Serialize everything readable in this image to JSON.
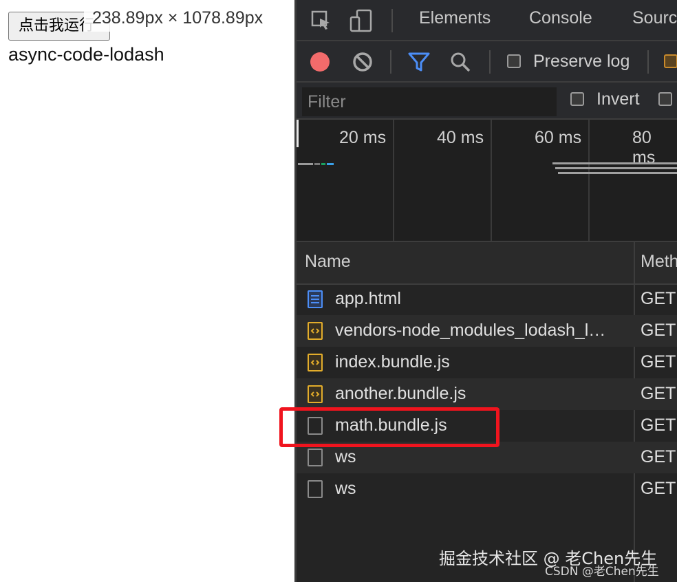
{
  "page": {
    "run_button": "点击我运行",
    "dimension_tooltip": "238.89px × 1078.89px",
    "body_text": "async-code-lodash"
  },
  "devtools": {
    "tabs": [
      "Elements",
      "Console",
      "Sourc"
    ],
    "toolbar2": {
      "preserve_log_label": "Preserve log",
      "record_color": "#f26b6b",
      "filter_icon_color": "#4c8ef7"
    },
    "filter": {
      "placeholder": "Filter",
      "invert_label": "Invert"
    },
    "timeline": {
      "ticks": [
        "20 ms",
        "40 ms",
        "60 ms",
        "80 ms"
      ]
    },
    "table": {
      "columns": [
        "Name",
        "Meth"
      ],
      "rows": [
        {
          "name": "app.html",
          "method": "GET",
          "icon": "document-icon"
        },
        {
          "name": "vendors-node_modules_lodash_l…",
          "method": "GET",
          "icon": "script-icon"
        },
        {
          "name": "index.bundle.js",
          "method": "GET",
          "icon": "script-icon"
        },
        {
          "name": "another.bundle.js",
          "method": "GET",
          "icon": "script-icon"
        },
        {
          "name": "math.bundle.js",
          "method": "GET",
          "icon": "blank-file-icon"
        },
        {
          "name": "ws",
          "method": "GET",
          "icon": "blank-file-icon"
        },
        {
          "name": "ws",
          "method": "GET",
          "icon": "blank-file-icon"
        }
      ],
      "highlight_color": "#f0141e"
    }
  },
  "watermark": {
    "line1": "掘金技术社区 @ 老Chen先生",
    "line2": "CSDN @老Chen先生"
  }
}
